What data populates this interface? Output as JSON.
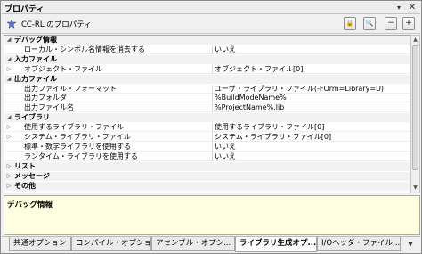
{
  "window": {
    "title": "プロパティ"
  },
  "toolbar": {
    "title": "CC-RL のプロパティ",
    "buttons": {
      "lock": "🔒",
      "search": "🔍",
      "collapse": "−",
      "expand": "+"
    }
  },
  "properties": [
    {
      "type": "category",
      "name": "デバッグ情報",
      "expanded": true
    },
    {
      "type": "property",
      "name": "ローカル・シンボル名情報を消去する",
      "value": "いいえ",
      "expandable": false
    },
    {
      "type": "category",
      "name": "入力ファイル",
      "expanded": true
    },
    {
      "type": "property",
      "name": "オブジェクト・ファイル",
      "value": "オブジェクト・ファイル[0]",
      "expandable": true
    },
    {
      "type": "category",
      "name": "出力ファイル",
      "expanded": true
    },
    {
      "type": "property",
      "name": "出力ファイル・フォーマット",
      "value": "ユーザ・ライブラリ・ファイル(-FOrm=Library=U)",
      "expandable": false
    },
    {
      "type": "property",
      "name": "出力フォルダ",
      "value": "%BuildModeName%",
      "expandable": false
    },
    {
      "type": "property",
      "name": "出力ファイル名",
      "value": "%ProjectName%.lib",
      "expandable": false
    },
    {
      "type": "category",
      "name": "ライブラリ",
      "expanded": true
    },
    {
      "type": "property",
      "name": "使用するライブラリ・ファイル",
      "value": "使用するライブラリ・ファイル[0]",
      "expandable": true
    },
    {
      "type": "property",
      "name": "システム・ライブラリ・ファイル",
      "value": "システム・ライブラリ・ファイル[0]",
      "expandable": true
    },
    {
      "type": "property",
      "name": "標準・数学ライブラリを使用する",
      "value": "いいえ",
      "expandable": false
    },
    {
      "type": "property",
      "name": "ランタイム・ライブラリを使用する",
      "value": "いいえ",
      "expandable": false
    },
    {
      "type": "category",
      "name": "リスト",
      "expanded": false
    },
    {
      "type": "category",
      "name": "メッセージ",
      "expanded": false
    },
    {
      "type": "category",
      "name": "その他",
      "expanded": false
    }
  ],
  "description": {
    "title": "デバッグ情報"
  },
  "tabs": [
    {
      "label": "共通オプション",
      "active": false
    },
    {
      "label": "コンパイル・オプション",
      "active": false
    },
    {
      "label": "アセンブル・オプシ...",
      "active": false
    },
    {
      "label": "ライブラリ生成オプ...",
      "active": true
    },
    {
      "label": "I/Oヘッダ・ファイル...",
      "active": false
    }
  ],
  "colors": {
    "category_bg": "#f2f2f2",
    "description_bg": "#ffffe1",
    "grid_bg": "#ffffff"
  }
}
